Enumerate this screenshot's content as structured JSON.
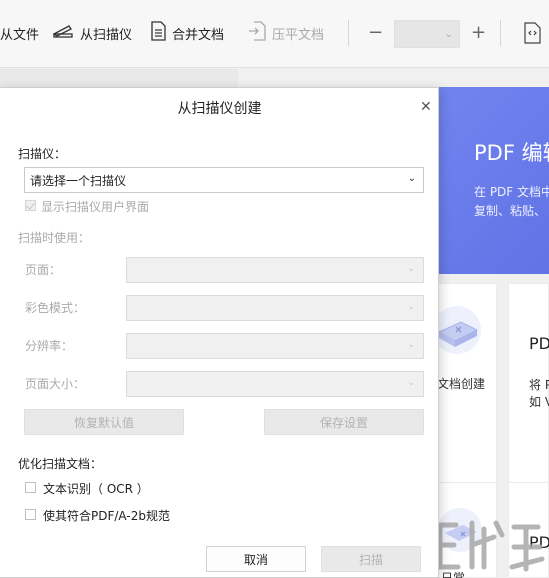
{
  "toolbar": {
    "from_file": "从文件",
    "from_scanner": "从扫描仪",
    "merge_docs": "合并文档",
    "flatten_docs": "压平文档",
    "zoom_minus": "−",
    "zoom_plus": "+"
  },
  "background": {
    "banner_title": "PDF 编辑",
    "banner_line1": "在 PDF 文档中",
    "banner_line2": "复制、粘贴、",
    "card_label_create": "文档创建",
    "card_pdf_1": "PD",
    "card_line_1": "将 P",
    "card_line_2": "如 V",
    "card_pdf_2": "PD",
    "card_bottom_label": "日常"
  },
  "dialog": {
    "title": "从扫描仪创建",
    "scanner_label": "扫描仪：",
    "scanner_value": "请选择一个扫描仪",
    "show_ui_label": "显示扫描仪用户界面",
    "use_when_scanning": "扫描时使用：",
    "page_label": "页面：",
    "color_mode_label": "彩色模式：",
    "resolution_label": "分辨率：",
    "page_size_label": "页面大小：",
    "restore_defaults": "恢复默认值",
    "save_settings": "保存设置",
    "optimize_label": "优化扫描文档：",
    "ocr_label": "文本识别（ OCR ）",
    "pdfa_label": "使其符合PDF/A-2b规范",
    "cancel": "取消",
    "scan": "扫描"
  },
  "colors": {
    "banner_accent": "#6f82ee",
    "dialog_bg": "#ffffff",
    "disabled_text": "#aaaaaa"
  }
}
